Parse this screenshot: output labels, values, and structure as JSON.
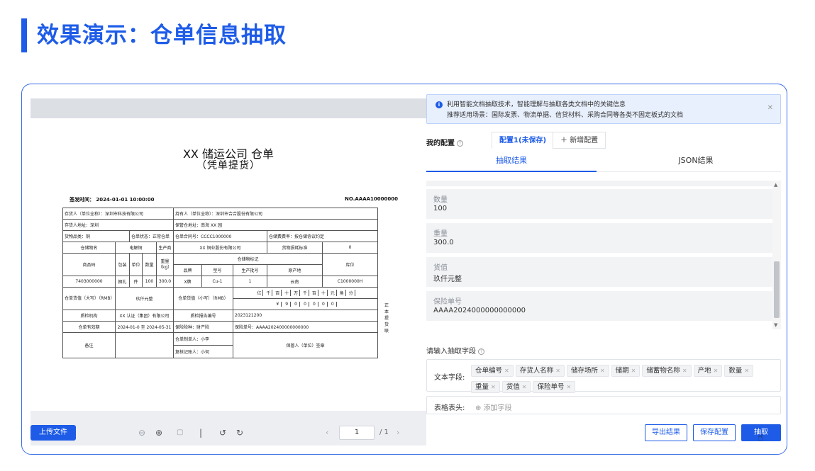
{
  "slide": {
    "title": "效果演示：仓单信息抽取"
  },
  "viewer": {
    "document": {
      "title": "XX 储运公司 仓单",
      "subtitle": "（凭单提货）",
      "issue_time": "签发时间：  2024-01-01 10:00:00",
      "number": "NO.AAAA10000000",
      "table_rows": [
        [
          "存货人（单位全称）：深圳市科技有限公司",
          "持有人（单位全称）：深圳市合合股份有限公司"
        ],
        [
          "存货人地址：深圳",
          "保管仓地址：南海 XX 园"
        ],
        [
          "货物品类：铜",
          "仓单状态：正常仓单",
          "仓单合同号：CCCC1000000",
          "仓储费费率：按仓储协议约定"
        ],
        [
          "仓储物名",
          "电解铜",
          "生产商",
          "XX 铜业股份有限公司",
          "货物损耗标准",
          "0"
        ],
        [
          "商品码",
          "包装",
          "单位",
          "数量",
          "重量（kg）",
          "仓储物标记",
          "品牌",
          "型号",
          "生产批号",
          "原产地",
          "库位"
        ],
        [
          "7403000000",
          "捆扎",
          "件",
          "100",
          "300.0",
          "X牌",
          "Cu-1",
          "1",
          "云南",
          "C1000000H"
        ],
        [
          "仓单货值（大写）（RMB）",
          "玖仟元整",
          "仓单货值（小写）（RMB）",
          "亿",
          "千",
          "百",
          "十",
          "万",
          "千",
          "百",
          "十",
          "元",
          "角",
          "分",
          "¥",
          "9",
          "0",
          "0",
          "0",
          "0",
          "0"
        ],
        [
          "质检机构",
          "XX 认证（集团）有限公司",
          "质检报告编号",
          "2023121200"
        ],
        [
          "仓单有效期",
          "2024-01-0 至 2024-05-31",
          "保险险种：财产险",
          "保险单号：AAAA202400000000000"
        ],
        [
          "备注",
          "仓单制单人：小李",
          "复核记账人：小何",
          "保管人（单位）签章"
        ]
      ],
      "side_note": "正本提货联"
    },
    "toolbar": {
      "upload_label": "上传文件",
      "current_page": "1",
      "total_pages": "/ 1"
    }
  },
  "panel": {
    "alert": {
      "line1": "利用智能文档抽取技术，智能理解与抽取各类文档中的关键信息",
      "line2": "推荐适用场景：国际发票、物流单据、信贷材料、采购合同等各类不固定板式的文档"
    },
    "config": {
      "label": "我的配置",
      "active_tab": "配置1(未保存)",
      "add_tab": "＋ 新增配置"
    },
    "result_tabs": [
      "抽取结果",
      "JSON结果"
    ],
    "results": [
      {
        "name": "数量",
        "value": "100"
      },
      {
        "name": "重量",
        "value": "300.0"
      },
      {
        "name": "货值",
        "value": "玖仟元整"
      },
      {
        "name": "保险单号",
        "value": "AAAA2024000000000000"
      }
    ],
    "enter_fields_label": "请输入抽取字段",
    "text_fields_label": "文本字段:",
    "tags": [
      "仓单编号",
      "存货人名称",
      "储存场所",
      "储期",
      "储蓄物名称",
      "产地",
      "数量",
      "重量",
      "货值",
      "保险单号"
    ],
    "table_header_label": "表格表头:",
    "add_field": "⊕ 添加字段",
    "buttons": {
      "export": "导出结果",
      "save": "保存配置",
      "extract": "抽取"
    }
  }
}
